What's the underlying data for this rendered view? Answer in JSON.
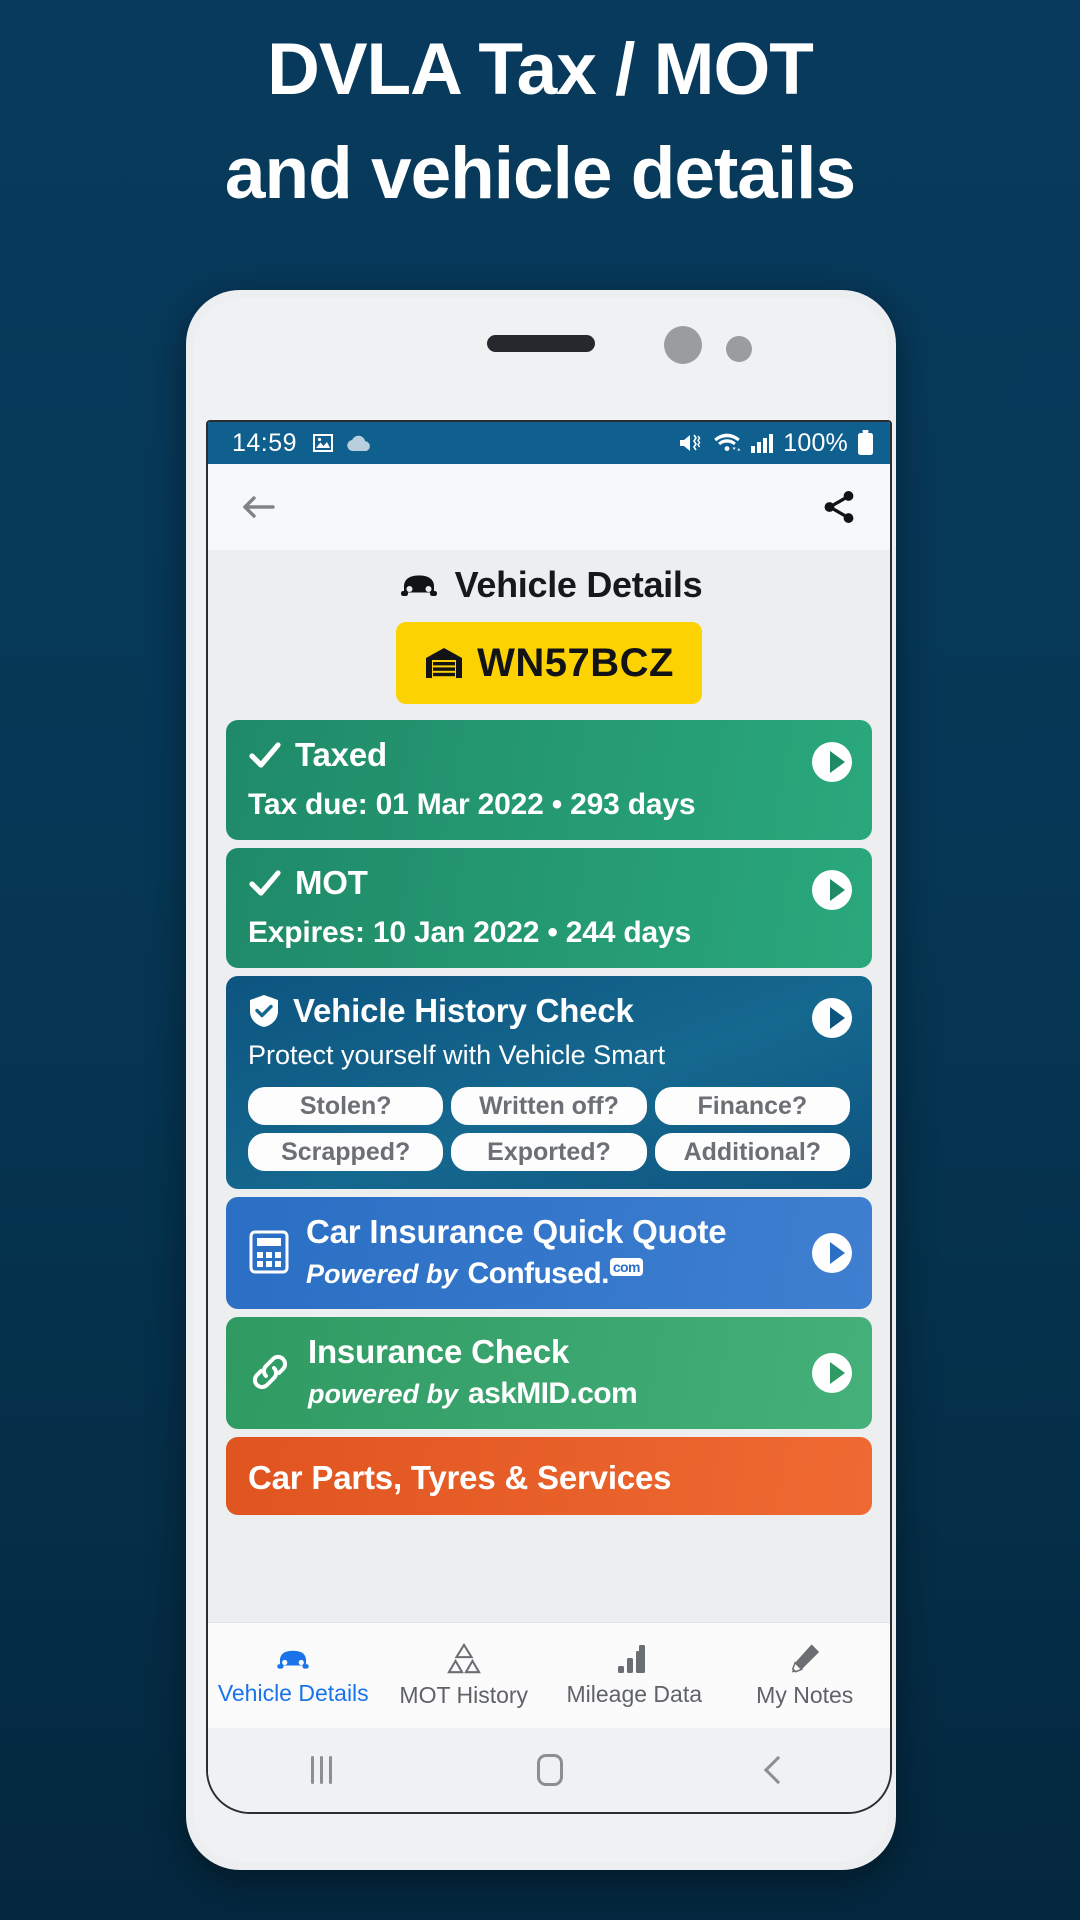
{
  "headline": {
    "line1": "DVLA Tax / MOT",
    "line2": "and vehicle details"
  },
  "statusbar": {
    "time": "14:59",
    "battery_percent": "100%",
    "icons": [
      "image-icon",
      "cloud-icon",
      "mute-vibrate-icon",
      "wifi-icon",
      "signal-bars-icon",
      "battery-icon"
    ]
  },
  "appbar": {
    "back": "back-arrow-icon",
    "share": "share-icon"
  },
  "header": {
    "title": "Vehicle Details",
    "title_icon": "car-icon",
    "registration": "WN57BCZ",
    "registration_icon": "garage-icon",
    "plate_color": "#fdd202"
  },
  "cards": [
    {
      "id": "tax",
      "title": "Taxed",
      "icon": "check-icon",
      "subtitle": "Tax due: 01 Mar 2022 • 293 days",
      "color": "#2aa87c"
    },
    {
      "id": "mot",
      "title": "MOT",
      "icon": "check-icon",
      "subtitle": "Expires: 10 Jan 2022 • 244 days",
      "color": "#2aa87c"
    },
    {
      "id": "history",
      "title": "Vehicle History Check",
      "icon": "shield-check-icon",
      "subtitle": "Protect yourself with Vehicle Smart",
      "color": "#15688f",
      "pills": [
        "Stolen?",
        "Written off?",
        "Finance?",
        "Scrapped?",
        "Exported?",
        "Additional?"
      ]
    },
    {
      "id": "quote",
      "title": "Car Insurance Quick Quote",
      "icon": "calculator-icon",
      "powered_prefix": "Powered by",
      "powered_brand": "Confused.",
      "powered_suffix": "com",
      "color": "#3f7fd0"
    },
    {
      "id": "insurance",
      "title": "Insurance Check",
      "icon": "link-icon",
      "powered_prefix": "powered by",
      "powered_brand": "askMID.com",
      "color": "#45b07a"
    },
    {
      "id": "parts",
      "title": "Car Parts, Tyres & Services",
      "color": "#ef6a32"
    }
  ],
  "tabs": [
    {
      "label": "Vehicle Details",
      "icon": "car-icon",
      "active": true
    },
    {
      "label": "MOT History",
      "icon": "mot-triangles-icon",
      "active": false
    },
    {
      "label": "Mileage Data",
      "icon": "bar-chart-icon",
      "active": false
    },
    {
      "label": "My Notes",
      "icon": "pencil-icon",
      "active": false
    }
  ],
  "androidnav": {
    "recent": "recent-apps-icon",
    "home": "home-icon",
    "back": "back-icon"
  }
}
